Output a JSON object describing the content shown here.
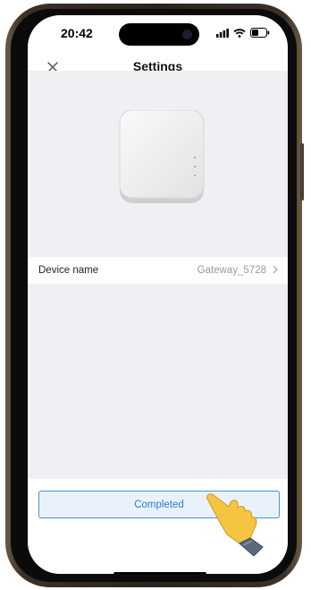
{
  "status_bar": {
    "time": "20:42"
  },
  "nav": {
    "title": "Settings",
    "close_icon": "close-icon"
  },
  "device": {
    "image": "gateway-device-image"
  },
  "settings_row": {
    "label": "Device name",
    "value": "Gateway_5728",
    "chevron_icon": "chevron-right-icon"
  },
  "footer": {
    "completed_label": "Completed"
  },
  "colors": {
    "accent": "#2c7bd6",
    "button_bg": "#e9f2fb",
    "content_bg": "#efeff4"
  }
}
